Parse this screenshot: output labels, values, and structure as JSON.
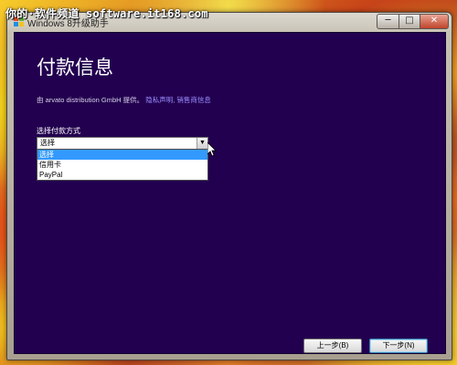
{
  "watermark": "你的·软件频道 software.it168.com",
  "window": {
    "title": "Windows 8升级助手",
    "controls": {
      "minimize": "─",
      "maximize": "□",
      "close": "✕"
    }
  },
  "page": {
    "title": "付款信息",
    "provider_text": "由 arvato distribution GmbH 提供。",
    "provider_links": "隐私声明, 销售商信息"
  },
  "payment": {
    "label": "选择付款方式",
    "selected": "选择",
    "options": [
      "选择",
      "信用卡",
      "PayPal"
    ]
  },
  "buttons": {
    "back": "上一步(B)",
    "next": "下一步(N)"
  }
}
